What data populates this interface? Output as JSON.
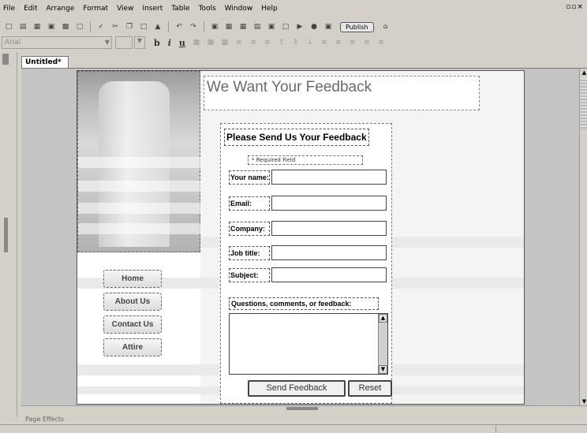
{
  "menubar": {
    "items": [
      {
        "label": "File"
      },
      {
        "label": "Edit"
      },
      {
        "label": "Arrange"
      },
      {
        "label": "Format"
      },
      {
        "label": "View"
      },
      {
        "label": "Insert"
      },
      {
        "label": "Table"
      },
      {
        "label": "Tools"
      },
      {
        "label": "Window"
      },
      {
        "label": "Help"
      }
    ]
  },
  "toolbar": {
    "publish_label": "Publish"
  },
  "format_toolbar": {
    "font_name": "Arial",
    "bold": "b",
    "italic": "i",
    "underline": "u"
  },
  "document": {
    "tab_label": "Untitled*"
  },
  "page": {
    "title": "We Want Your Feedback",
    "nav": [
      {
        "label": "Home"
      },
      {
        "label": "About Us"
      },
      {
        "label": "Contact Us"
      },
      {
        "label": "Attire"
      }
    ],
    "form": {
      "heading": "Please Send Us Your Feedback",
      "required_note": "* Required Field",
      "fields": [
        {
          "label": "Your name:"
        },
        {
          "label": "Email:"
        },
        {
          "label": "Company:"
        },
        {
          "label": "Job title:"
        },
        {
          "label": "Subject:"
        }
      ],
      "questions_label": "Questions, comments, or feedback:",
      "submit_label": "Send Feedback",
      "reset_label": "Reset"
    }
  },
  "bottom_panel": {
    "label": "Page Effects"
  }
}
